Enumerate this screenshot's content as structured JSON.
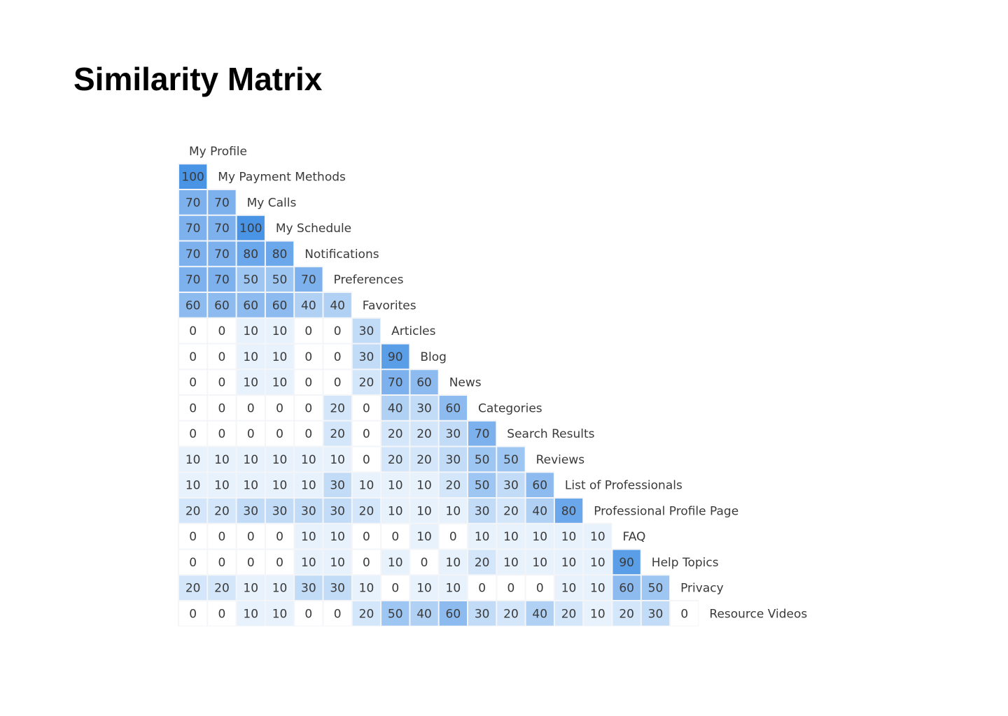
{
  "page": {
    "title": "Similarity Matrix"
  },
  "chart_data": {
    "type": "heatmap",
    "title": "Similarity Matrix",
    "layout": "lower-triangular",
    "value_range": [
      0,
      100
    ],
    "color_scale": {
      "low": "#ffffff",
      "high": "#4a94e6",
      "border": "#f3f5f8",
      "text": "#3a3a3a"
    },
    "labels": [
      "My Profile",
      "My Payment Methods",
      "My Calls",
      "My Schedule",
      "Notifications",
      "Preferences",
      "Favorites",
      "Articles",
      "Blog",
      "News",
      "Categories",
      "Search Results",
      "Reviews",
      "List of Professionals",
      "Professional Profile Page",
      "FAQ",
      "Help Topics",
      "Privacy",
      "Resource Videos"
    ],
    "rows": [
      [],
      [
        100
      ],
      [
        70,
        70
      ],
      [
        70,
        70,
        100
      ],
      [
        70,
        70,
        80,
        80
      ],
      [
        70,
        70,
        50,
        50,
        70
      ],
      [
        60,
        60,
        60,
        60,
        40,
        40
      ],
      [
        0,
        0,
        10,
        10,
        0,
        0,
        30
      ],
      [
        0,
        0,
        10,
        10,
        0,
        0,
        30,
        90
      ],
      [
        0,
        0,
        10,
        10,
        0,
        0,
        20,
        70,
        60
      ],
      [
        0,
        0,
        0,
        0,
        0,
        20,
        0,
        40,
        30,
        60
      ],
      [
        0,
        0,
        0,
        0,
        0,
        20,
        0,
        20,
        20,
        30,
        70
      ],
      [
        10,
        10,
        10,
        10,
        10,
        10,
        0,
        20,
        20,
        30,
        50,
        50
      ],
      [
        10,
        10,
        10,
        10,
        10,
        30,
        10,
        10,
        10,
        20,
        50,
        30,
        60
      ],
      [
        20,
        20,
        30,
        30,
        30,
        30,
        20,
        10,
        10,
        10,
        30,
        20,
        40,
        80
      ],
      [
        0,
        0,
        0,
        0,
        10,
        10,
        0,
        0,
        10,
        0,
        10,
        10,
        10,
        10,
        10
      ],
      [
        0,
        0,
        0,
        0,
        10,
        10,
        0,
        10,
        0,
        10,
        20,
        10,
        10,
        10,
        10,
        90
      ],
      [
        20,
        20,
        10,
        10,
        30,
        30,
        10,
        0,
        10,
        10,
        0,
        0,
        0,
        10,
        10,
        60,
        50
      ],
      [
        0,
        0,
        10,
        10,
        0,
        0,
        20,
        50,
        40,
        60,
        30,
        20,
        40,
        20,
        10,
        20,
        30,
        0
      ]
    ]
  }
}
